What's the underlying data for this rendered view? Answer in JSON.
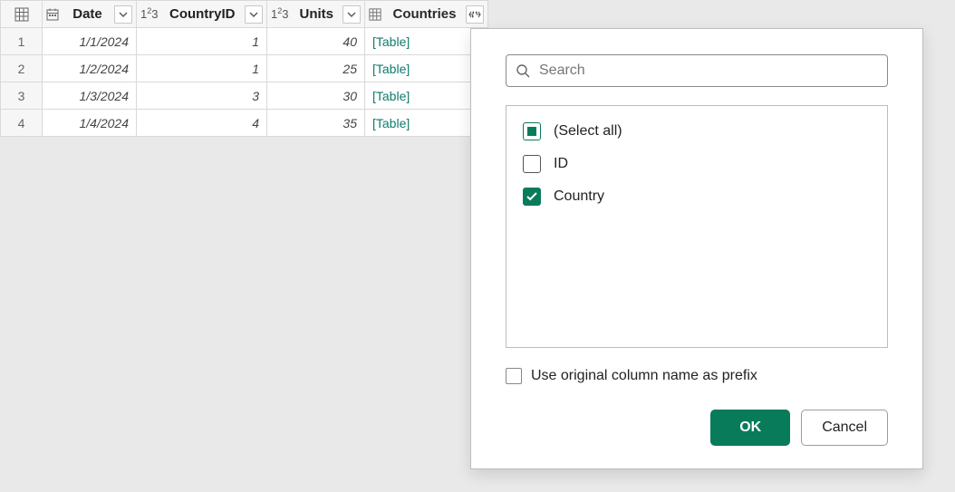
{
  "table": {
    "columns": [
      {
        "key": "date",
        "label": "Date",
        "type": "date"
      },
      {
        "key": "countryId",
        "label": "CountryID",
        "type": "number"
      },
      {
        "key": "units",
        "label": "Units",
        "type": "number"
      },
      {
        "key": "countries",
        "label": "Countries",
        "type": "table",
        "selected": true
      }
    ],
    "rows": [
      {
        "index": "1",
        "date": "1/1/2024",
        "countryId": "1",
        "units": "40",
        "countries": "[Table]"
      },
      {
        "index": "2",
        "date": "1/2/2024",
        "countryId": "1",
        "units": "25",
        "countries": "[Table]"
      },
      {
        "index": "3",
        "date": "1/3/2024",
        "countryId": "3",
        "units": "30",
        "countries": "[Table]"
      },
      {
        "index": "4",
        "date": "1/4/2024",
        "countryId": "4",
        "units": "35",
        "countries": "[Table]"
      }
    ]
  },
  "popup": {
    "search_placeholder": "Search",
    "select_all_label": "(Select all)",
    "columns": [
      {
        "key": "id",
        "label": "ID",
        "checked": false
      },
      {
        "key": "country",
        "label": "Country",
        "checked": true
      }
    ],
    "prefix_label": "Use original column name as prefix",
    "prefix_checked": false,
    "ok_label": "OK",
    "cancel_label": "Cancel"
  }
}
